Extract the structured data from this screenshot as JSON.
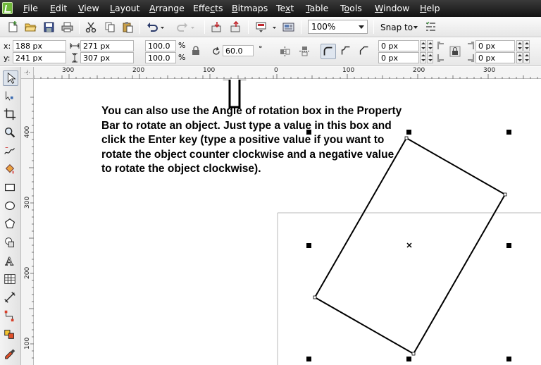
{
  "menu": {
    "items": [
      {
        "first": "F",
        "rest": "ile"
      },
      {
        "first": "E",
        "rest": "dit"
      },
      {
        "first": "V",
        "rest": "iew"
      },
      {
        "first": "L",
        "rest": "ayout"
      },
      {
        "first": "A",
        "rest": "rrange"
      },
      {
        "first": "",
        "rest": "Effe",
        "u": "c",
        "tail": "ts"
      },
      {
        "first": "B",
        "rest": "itmaps"
      },
      {
        "first": "",
        "rest": "Te",
        "u": "x",
        "tail": "t"
      },
      {
        "first": "",
        "rest": "",
        "u": "T",
        "tail": "able"
      },
      {
        "first": "",
        "rest": "T",
        "u": "o",
        "tail": "ols"
      },
      {
        "first": "W",
        "rest": "indow"
      },
      {
        "first": "H",
        "rest": "elp"
      }
    ]
  },
  "toolbar": {
    "zoom_value": "100%",
    "snap_label": "Snap to"
  },
  "property_bar": {
    "x_label": "x:",
    "x_value": "188 px",
    "y_label": "y:",
    "y_value": "241 px",
    "width_value": "271 px",
    "height_value": "307 px",
    "scale_x": "100.0",
    "scale_y": "100.0",
    "percent": "%",
    "angle_value": "60.0",
    "degree": "°",
    "outline_1": "0 px",
    "outline_2": "0 px",
    "outline_3": "0 px",
    "outline_4": "0 px"
  },
  "rulers": {
    "horizontal": [
      "300",
      "200",
      "100",
      "0",
      "100",
      "200",
      "300"
    ],
    "vertical": [
      "400",
      "300",
      "200",
      "100"
    ]
  },
  "instruction_text": "You can also use the Angle of rotation box in the Property Bar to rotate an object. Just type a value in this box and click the Enter key (type a positive value if you want to rotate the object counter clockwise and a negative value to rotate the object clockwise).",
  "colors": {
    "menubar": "#1c1c1c",
    "toolbar": "#ececec",
    "canvas": "#ffffff"
  }
}
